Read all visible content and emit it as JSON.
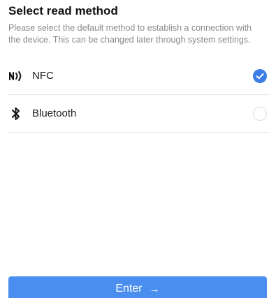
{
  "header": {
    "title": "Select read method",
    "description": "Please select the default method to establish a connection with the device. This can be changed later through system settings."
  },
  "options": [
    {
      "label": "NFC",
      "icon": "nfc-icon",
      "selected": true
    },
    {
      "label": "Bluetooth",
      "icon": "bluetooth-icon",
      "selected": false
    }
  ],
  "footer": {
    "enter_label": "Enter",
    "arrow": "→"
  },
  "colors": {
    "accent": "#3b7ee8",
    "button": "#4a8ef0"
  }
}
